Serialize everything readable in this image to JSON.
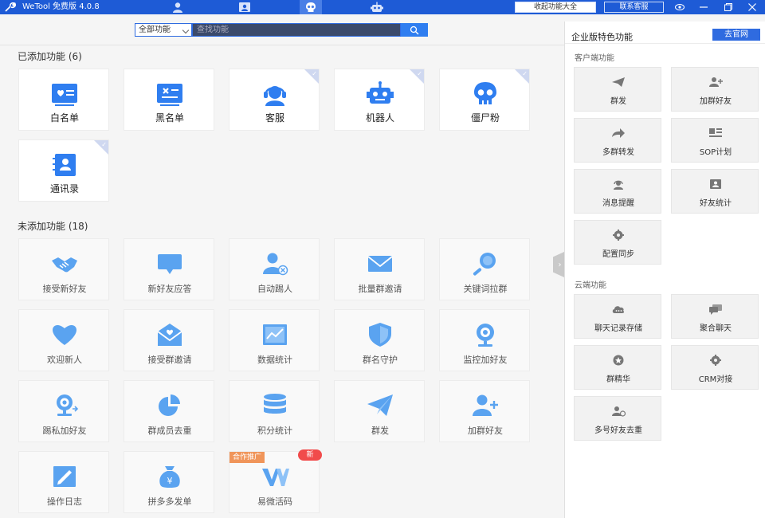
{
  "app": {
    "title": "WeTool 免费版 4.0.8"
  },
  "titlebar": {
    "nav_icons": [
      "person-icon",
      "contacts-card-icon",
      "skull-icon",
      "robot-icon"
    ],
    "collapse_label": "收起功能大全",
    "contact_label": "联系客服"
  },
  "search": {
    "category": "全部功能",
    "placeholder": "查找功能"
  },
  "added": {
    "title": "已添加功能 (6)",
    "items": [
      {
        "label": "白名单",
        "icon": "whitelist-icon"
      },
      {
        "label": "黑名单",
        "icon": "blacklist-icon"
      },
      {
        "label": "客服",
        "icon": "customer-service-icon"
      },
      {
        "label": "机器人",
        "icon": "robot-icon"
      },
      {
        "label": "僵尸粉",
        "icon": "skull-icon"
      },
      {
        "label": "通讯录",
        "icon": "address-book-icon"
      }
    ]
  },
  "unadded": {
    "title": "未添加功能 (18)",
    "items": [
      {
        "label": "接受新好友",
        "icon": "handshake-icon"
      },
      {
        "label": "新好友应答",
        "icon": "chat-bubble-icon"
      },
      {
        "label": "自动踢人",
        "icon": "user-remove-icon"
      },
      {
        "label": "批量群邀请",
        "icon": "envelope-icon"
      },
      {
        "label": "关键词拉群",
        "icon": "magnifier-icon"
      },
      {
        "label": "欢迎新人",
        "icon": "heart-icon"
      },
      {
        "label": "接受群邀请",
        "icon": "open-mail-icon"
      },
      {
        "label": "数据统计",
        "icon": "line-chart-icon"
      },
      {
        "label": "群名守护",
        "icon": "shield-icon"
      },
      {
        "label": "监控加好友",
        "icon": "webcam-icon"
      },
      {
        "label": "踢私加好友",
        "icon": "webcam-kick-icon"
      },
      {
        "label": "群成员去重",
        "icon": "pie-chart-icon"
      },
      {
        "label": "积分统计",
        "icon": "database-icon"
      },
      {
        "label": "群发",
        "icon": "paper-plane-icon"
      },
      {
        "label": "加群好友",
        "icon": "user-add-icon"
      },
      {
        "label": "操作日志",
        "icon": "log-edit-icon"
      },
      {
        "label": "拼多多发单",
        "icon": "money-bag-icon"
      },
      {
        "label": "易微活码",
        "icon": "yiwei-logo-icon",
        "promo": "合作推广",
        "badge": "新"
      }
    ]
  },
  "enterprise": {
    "title": "企业版特色功能",
    "site_button": "去官网",
    "client_title": "客户端功能",
    "client_items": [
      {
        "label": "群发",
        "icon": "paper-plane-icon"
      },
      {
        "label": "加群好友",
        "icon": "user-add-icon"
      },
      {
        "label": "多群转发",
        "icon": "forward-arrow-icon"
      },
      {
        "label": "SOP计划",
        "icon": "plan-list-icon"
      },
      {
        "label": "消息提醒",
        "icon": "headset-icon"
      },
      {
        "label": "好友统计",
        "icon": "contact-card-icon"
      },
      {
        "label": "配置同步",
        "icon": "gear-icon"
      }
    ],
    "cloud_title": "云端功能",
    "cloud_items": [
      {
        "label": "聊天记录存储",
        "icon": "cloud-chat-icon"
      },
      {
        "label": "聚合聊天",
        "icon": "chat-bubbles-icon"
      },
      {
        "label": "群精华",
        "icon": "star-badge-icon"
      },
      {
        "label": "CRM对接",
        "icon": "gear-icon"
      },
      {
        "label": "多号好友去重",
        "icon": "users-icon"
      }
    ]
  }
}
